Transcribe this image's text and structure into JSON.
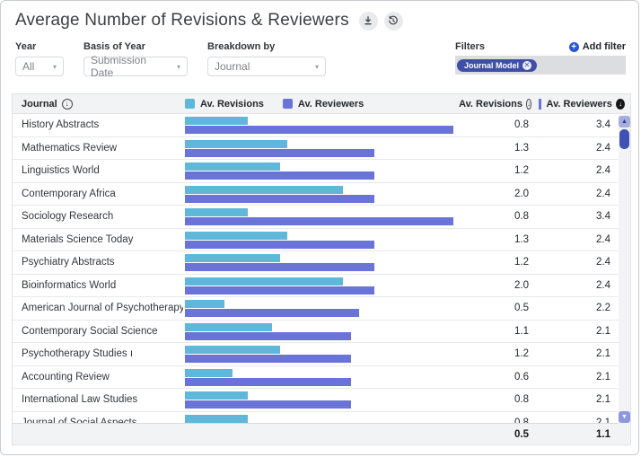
{
  "app": {
    "title": "Average Number of Revisions & Reviewers",
    "title_icons": [
      "download-icon",
      "history-icon"
    ]
  },
  "controls": {
    "year": {
      "label": "Year",
      "value": "All"
    },
    "basis_of_year": {
      "label": "Basis of Year",
      "value": "Submission Date"
    },
    "breakdown_by": {
      "label": "Breakdown by",
      "value": "Journal"
    },
    "filters": {
      "label": "Filters",
      "add_filter_label": "Add filter",
      "chips": [
        {
          "label": "Journal Model",
          "icon": "circle-x-icon"
        }
      ]
    }
  },
  "table": {
    "journal_column_label": "Journal",
    "journal_sort_icon": "arrow-circle-down-outline",
    "value_columns": [
      {
        "label": "Av. Revisions",
        "accent": "#5fb8da",
        "sort_icon": "arrow-circle-down-outline",
        "sort_state": "unsorted"
      },
      {
        "label": "Av. Reviewers",
        "accent": "#6a74d8",
        "sort_icon": "arrow-circle-down-filled",
        "sort_state": "sorted-desc"
      }
    ],
    "footer": {
      "revisions_avg": "0.5",
      "reviewers_avg": "1.1"
    }
  },
  "chart_data": {
    "type": "bar",
    "orientation": "horizontal",
    "title": "Average Number of Revisions & Reviewers",
    "categories": [
      "History Abstracts",
      "Mathematics Review",
      "Linguistics World",
      "Contemporary Africa",
      "Sociology Research",
      "Materials Science Today",
      "Psychiatry Abstracts",
      "Bioinformatics World",
      "American Journal of Psychotherapy",
      "Contemporary Social Science",
      "Psychotherapy Studies ı",
      "Accounting Review",
      "International Law Studies",
      "Journal of Social Aspects"
    ],
    "series": [
      {
        "name": "Av. Revisions",
        "color": "#5fb8da",
        "values": [
          0.8,
          1.3,
          1.2,
          2.0,
          0.8,
          1.3,
          1.2,
          2.0,
          0.5,
          1.1,
          1.2,
          0.6,
          0.8,
          0.8
        ]
      },
      {
        "name": "Av. Reviewers",
        "color": "#6a74d8",
        "values": [
          3.4,
          2.4,
          2.4,
          2.4,
          3.4,
          2.4,
          2.4,
          2.4,
          2.2,
          2.1,
          2.1,
          2.1,
          2.1,
          2.1
        ]
      }
    ],
    "xlim": [
      0,
      3.5
    ],
    "grid": false,
    "legend_position": "top",
    "summary_row": {
      "Av. Revisions": 0.5,
      "Av. Reviewers": 1.1
    }
  },
  "colors": {
    "chip_bg": "#3e4fa8",
    "add_filter_plus": "#2b56d6",
    "scroll_thumb": "#3f51b5",
    "table_header_bg": "#f1f3f4"
  }
}
